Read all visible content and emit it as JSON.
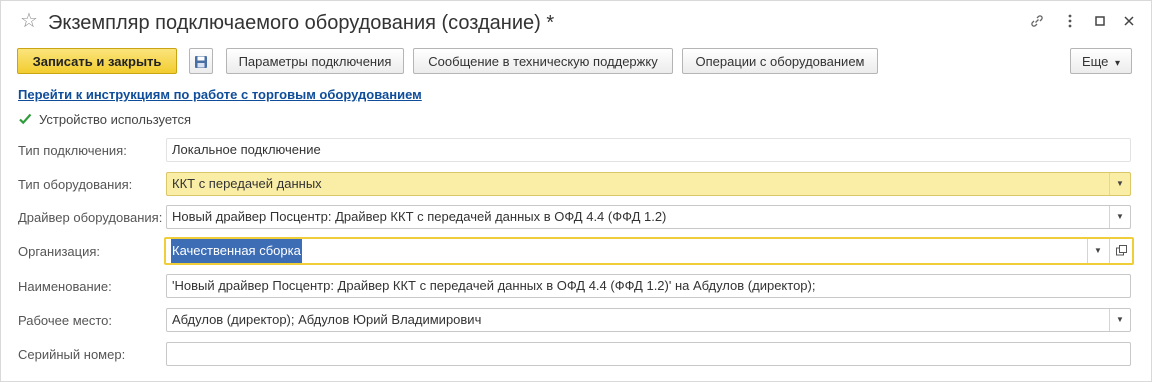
{
  "window": {
    "title": "Экземпляр подключаемого оборудования (создание) *",
    "star": "☆",
    "icons": {
      "link": "link-icon",
      "more": "more-vertical-icon",
      "maximize": "maximize-icon",
      "close": "close-icon"
    }
  },
  "toolbar": {
    "save_close": "Записать и закрыть",
    "save_icon": "floppy-disk-icon",
    "connection_params": "Параметры подключения",
    "support_message": "Сообщение в техническую поддержку",
    "equipment_operations": "Операции с оборудованием",
    "more": "Еще",
    "more_arrow": "▾"
  },
  "instructions_link": "Перейти к инструкциям по работе с торговым оборудованием",
  "device_used": {
    "label": "Устройство используется",
    "checked": true
  },
  "form": {
    "connection_type": {
      "label": "Тип подключения:",
      "value": "Локальное подключение"
    },
    "equipment_type": {
      "label": "Тип оборудования:",
      "value": "ККТ с передачей данных"
    },
    "driver": {
      "label": "Драйвер оборудования:",
      "value": "Новый драйвер Посцентр: Драйвер ККТ с передачей данных в ОФД 4.4 (ФФД 1.2)"
    },
    "organization": {
      "label": "Организация:",
      "value": "Качественная сборка"
    },
    "name": {
      "label": "Наименование:",
      "value": "'Новый драйвер Посцентр: Драйвер ККТ с передачей данных в ОФД 4.4 (ФФД 1.2)' на Абдулов (директор);"
    },
    "workplace": {
      "label": "Рабочее место:",
      "value": "Абдулов (директор); Абдулов Юрий Владимирович"
    },
    "serial": {
      "label": "Серийный номер:",
      "value": ""
    }
  },
  "colors": {
    "primary_button": "#f2cd2f",
    "link": "#0f4d9a",
    "highlight_field": "#faeea6",
    "focus_border": "#f0ce3a",
    "selection": "#3d6db5"
  }
}
